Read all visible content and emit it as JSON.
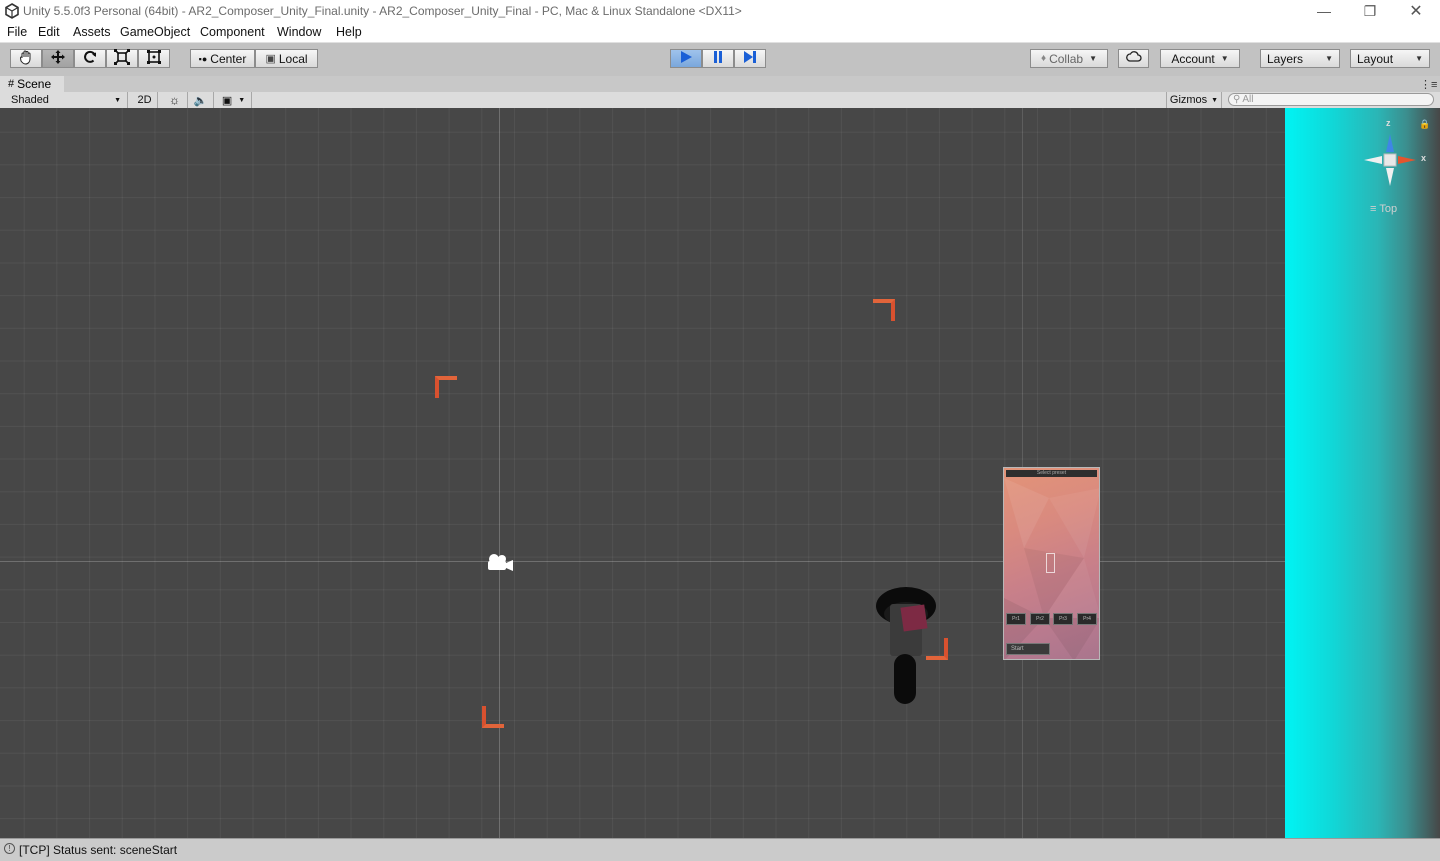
{
  "window": {
    "title": "Unity 5.5.0f3 Personal (64bit) - AR2_Composer_Unity_Final.unity - AR2_Composer_Unity_Final - PC, Mac & Linux Standalone <DX11>",
    "minimize_icon": "minimize-icon",
    "restore_icon": "restore-icon",
    "close_icon": "close-icon"
  },
  "menu": [
    "File",
    "Edit",
    "Assets",
    "GameObject",
    "Component",
    "Window",
    "Help"
  ],
  "toolbar": {
    "tools": [
      "hand-icon",
      "move-icon",
      "rotate-icon",
      "scale-icon",
      "rect-tool-icon"
    ],
    "pivot_label": "Center",
    "space_label": "Local",
    "collab_label": "Collab",
    "account_label": "Account",
    "layers_label": "Layers",
    "layout_label": "Layout"
  },
  "scene": {
    "tab_label": "Scene",
    "shading_mode": "Shaded",
    "mode_2d": "2D",
    "gizmos_label": "Gizmos",
    "search_placeholder": "All",
    "view_label": "Top",
    "axis_z": "z",
    "axis_x": "x",
    "cyan_color": "#00f2f2",
    "grid_color": "#474747"
  },
  "panel": {
    "header_text": "Select preset",
    "buttons": [
      "Pr1",
      "Pr2",
      "Pr3",
      "Pr4"
    ],
    "bottom_button": "Start"
  },
  "status": {
    "message": "[TCP] Status sent: sceneStart"
  }
}
